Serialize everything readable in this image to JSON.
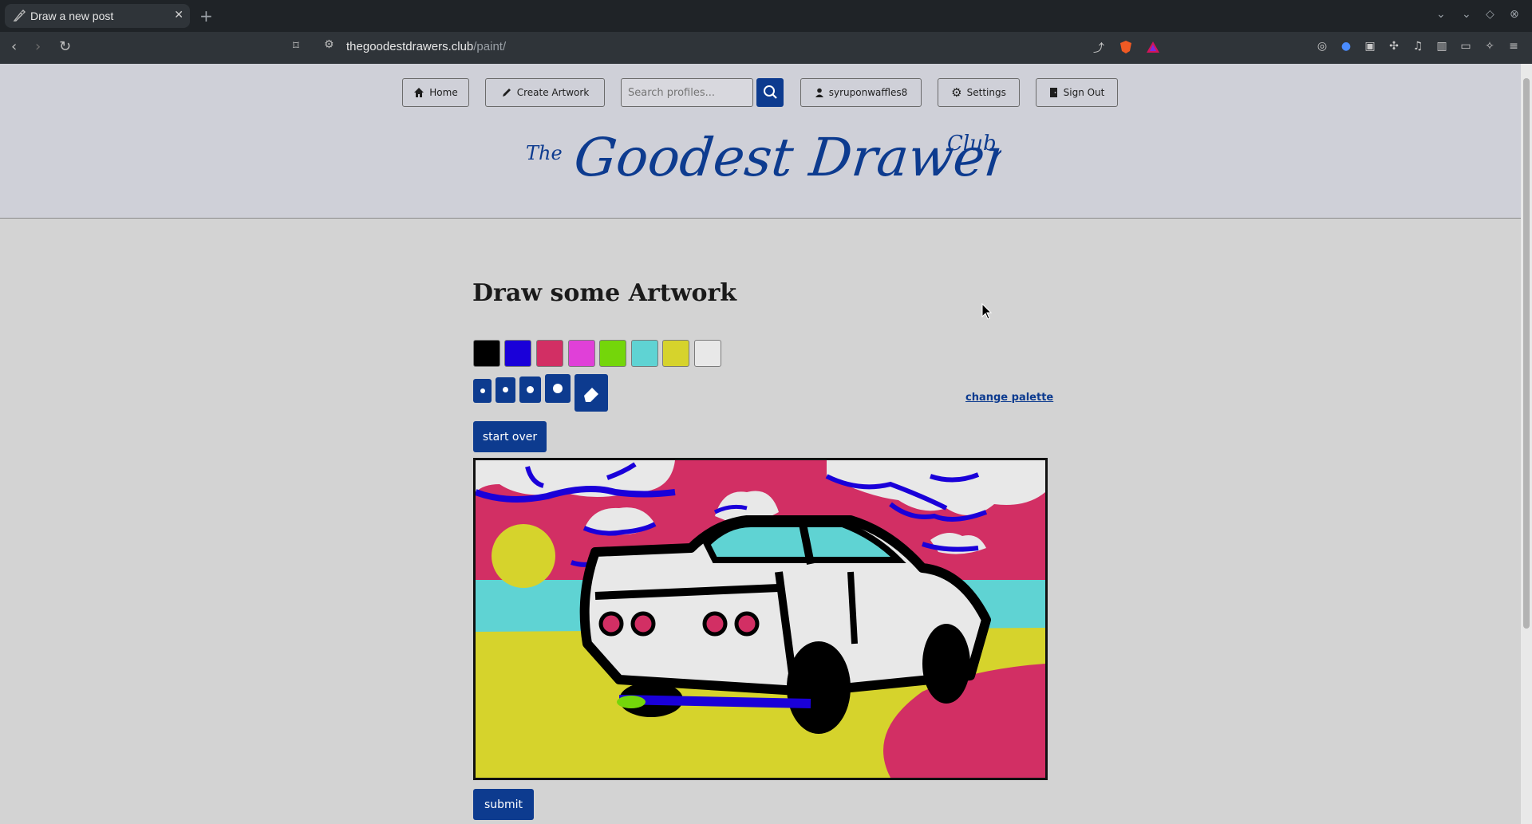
{
  "browser": {
    "tab_title": "Draw a new post",
    "new_tab_label": "+",
    "url_host": "thegoodestdrawers.club",
    "url_path": "/paint/"
  },
  "nav": {
    "home_label": "Home",
    "create_label": "Create Artwork",
    "search_placeholder": "Search profiles...",
    "user_label": "syruponwaffles8",
    "settings_label": "Settings",
    "signout_label": "Sign Out"
  },
  "logo": {
    "the": "The",
    "name": "Goodest Drawers",
    "club": "Club"
  },
  "main": {
    "heading": "Draw some Artwork",
    "palette": [
      "#000000",
      "#1a00d9",
      "#d22f64",
      "#e040d8",
      "#74d60a",
      "#5fd3d3",
      "#d6d32c",
      "#e8e8e8"
    ],
    "change_palette_label": "change palette",
    "start_over_label": "start over",
    "submit_label": "submit"
  },
  "colors": {
    "accent": "#0d3b8f",
    "header_bg": "#cfd0d8",
    "page_bg": "#d3d3d3"
  }
}
